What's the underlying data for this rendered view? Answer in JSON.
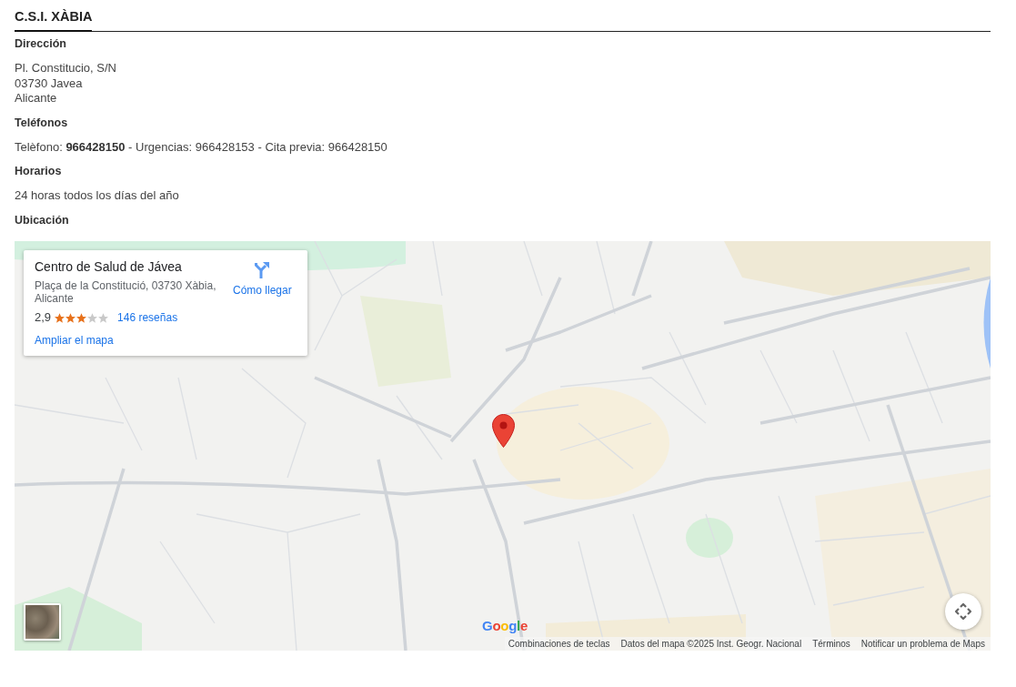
{
  "page": {
    "title": "C.S.I. XÀBIA"
  },
  "sections": [
    {
      "kind": "address",
      "label": "Dirección",
      "lines": [
        "Pl. Constitucio, S/N",
        "03730 Javea",
        "Alicante"
      ]
    },
    {
      "kind": "phones",
      "label": "Teléfonos",
      "text": "Telèfono: **966428150** - Urgencias: 966428153 - Cita previa: 966428150"
    },
    {
      "kind": "hours",
      "label": "Horarios",
      "text": "24 horas todos los días del año"
    },
    {
      "kind": "map",
      "label": "Ubicación"
    }
  ],
  "map": {
    "info_card": {
      "name": "Centro de Salud de Jávea",
      "address": "Plaça de la Constitució, 03730 Xàbia, Alicante",
      "rating": "2,9",
      "stars": 3,
      "reviews": "146 reseñas",
      "directions": "Cómo llegar",
      "enlarge": "Ampliar el mapa"
    },
    "logo": "Google",
    "footer_links": [
      "Combinaciones de teclas",
      "Datos del mapa ©2025 Inst. Geogr. Nacional",
      "Términos",
      "Notificar un problema de Maps"
    ]
  }
}
